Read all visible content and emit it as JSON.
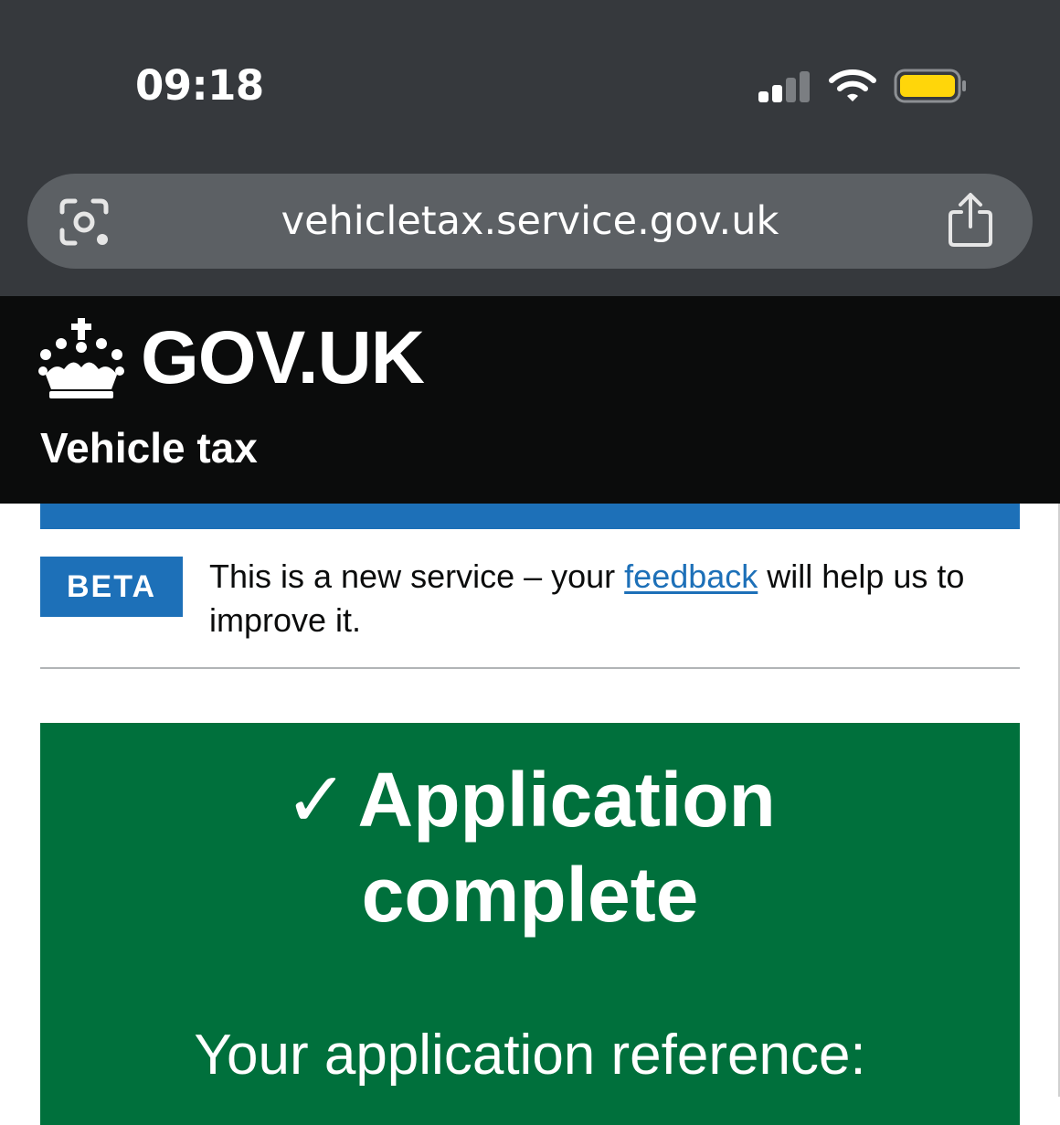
{
  "status_bar": {
    "time": "09:18"
  },
  "browser": {
    "url": "vehicletax.service.gov.uk",
    "icons": {
      "lens": "camera-lens-icon",
      "share": "share-icon"
    }
  },
  "header": {
    "logotype": "GOV.UK",
    "service_name": "Vehicle tax",
    "icons": {
      "crown": "crown-icon"
    }
  },
  "phase_banner": {
    "tag": "BETA",
    "text_before": "This is a new service – your ",
    "link": "feedback",
    "text_after": " will help us to improve it."
  },
  "confirmation": {
    "check": "✓",
    "title_line1": "Application",
    "title_line2": "complete",
    "reference_label": "Your application reference:"
  },
  "colors": {
    "chrome": "#36393d",
    "urlbar": "#5c6064",
    "header": "#0b0c0c",
    "govuk_blue": "#1d70b8",
    "success_green": "#00703c",
    "battery_yellow": "#ffd60a"
  }
}
